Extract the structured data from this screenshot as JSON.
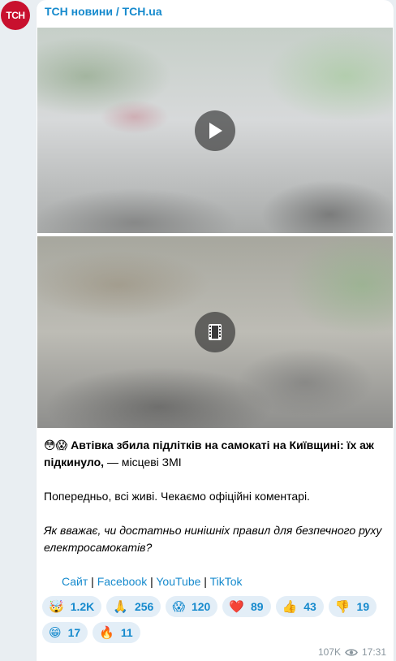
{
  "channel": {
    "name": "ТСН новини / TCH.ua",
    "avatar_text": "ТСН",
    "brand_color": "#c8102e",
    "link_color": "#168acd"
  },
  "media": [
    {
      "type": "video",
      "icon": "play-icon"
    },
    {
      "type": "video",
      "icon": "film-icon"
    }
  ],
  "post": {
    "headline_emojis": "😳😱",
    "headline_bold": "Автівка збила підлітків на самокаті на Київщині: їх аж підкинуло,",
    "headline_rest": " — місцеві ЗМІ",
    "paragraph2": "Попередньо, всі живі. Чекаємо офіційні коментарі.",
    "question": "Як вважає, чи достатньо нинішніх правил для безпечного руху електросамокатів?",
    "links": {
      "site": "Сайт",
      "sep1": " | ",
      "facebook": "Facebook",
      "sep2": " | ",
      "youtube": "YouTube",
      "sep3": " | ",
      "tiktok": "TikTok"
    }
  },
  "reactions": [
    {
      "emoji": "🤯",
      "count": "1.2K",
      "name": "exploding-head"
    },
    {
      "emoji": "🙏",
      "count": "256",
      "name": "pray"
    },
    {
      "emoji": "😱",
      "count": "120",
      "name": "scream"
    },
    {
      "emoji": "❤️",
      "count": "89",
      "name": "heart"
    },
    {
      "emoji": "👍",
      "count": "43",
      "name": "thumbs-up"
    },
    {
      "emoji": "👎",
      "count": "19",
      "name": "thumbs-down"
    },
    {
      "emoji": "😁",
      "count": "17",
      "name": "grin"
    },
    {
      "emoji": "🔥",
      "count": "11",
      "name": "fire"
    }
  ],
  "meta": {
    "views": "107K",
    "time": "17:31",
    "views_icon": "eye-icon"
  }
}
